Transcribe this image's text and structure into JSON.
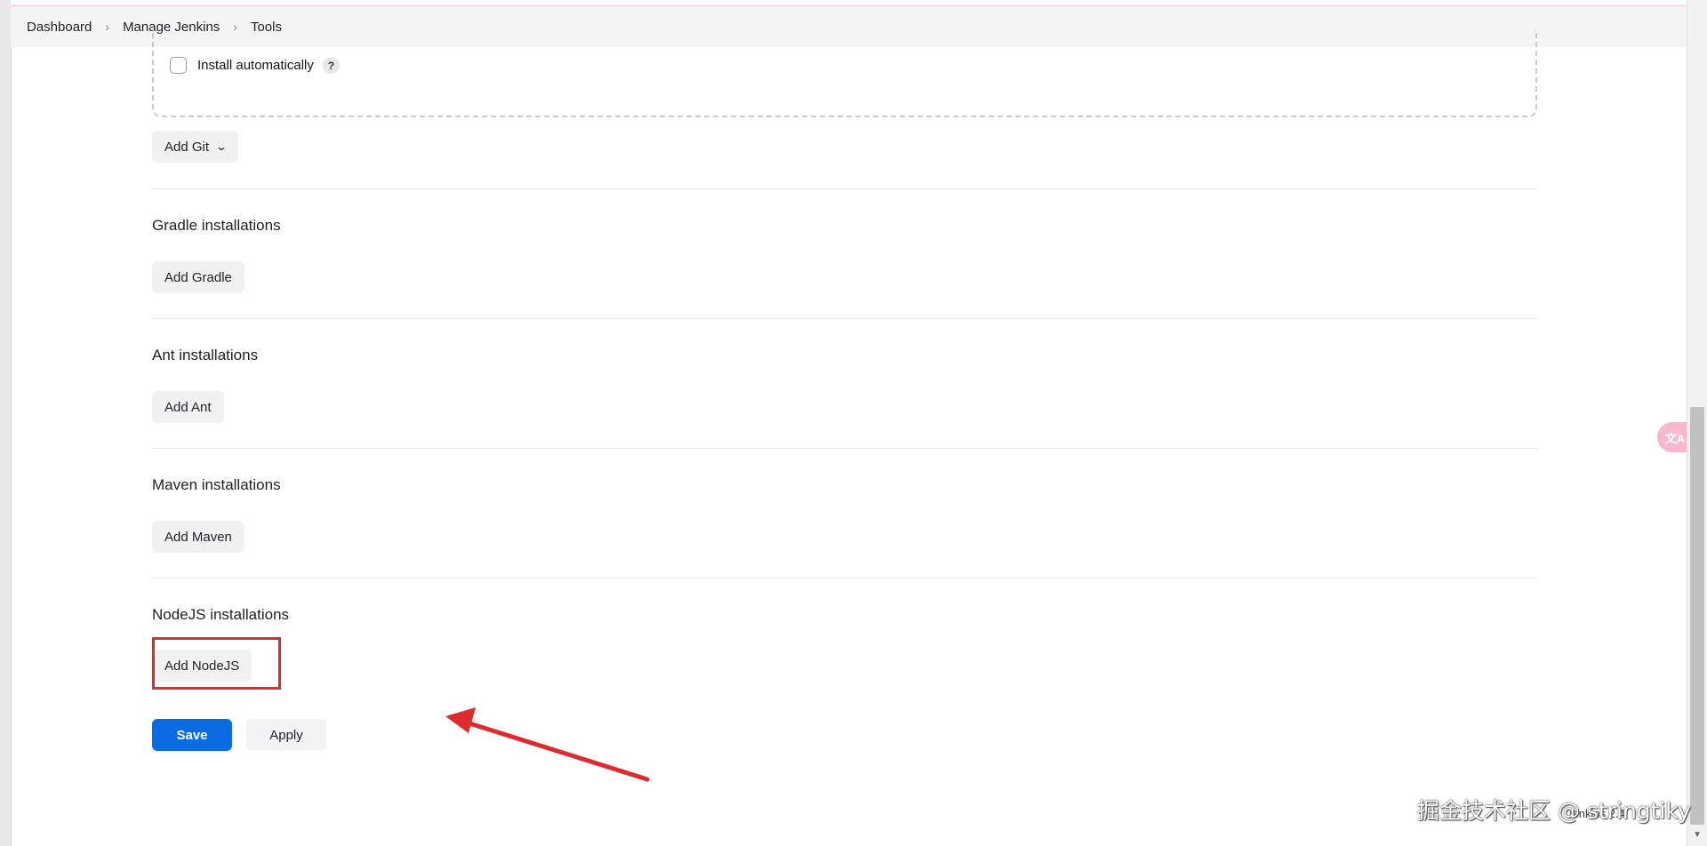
{
  "breadcrumb": {
    "items": [
      "Dashboard",
      "Manage Jenkins",
      "Tools"
    ],
    "separator": "›"
  },
  "git": {
    "install_automatically_label": "Install automatically",
    "install_automatically_checked": false,
    "help_label": "?",
    "add_button": "Add Git"
  },
  "sections": {
    "gradle": {
      "title": "Gradle installations",
      "add_button": "Add Gradle"
    },
    "ant": {
      "title": "Ant installations",
      "add_button": "Add Ant"
    },
    "maven": {
      "title": "Maven installations",
      "add_button": "Add Maven"
    },
    "nodejs": {
      "title": "NodeJS installations",
      "add_button": "Add NodeJS"
    }
  },
  "actions": {
    "save": "Save",
    "apply": "Apply"
  },
  "footer": {
    "version": "Jenkins 2.4"
  },
  "watermark": "掘金技术社区 @ stringtiky",
  "translate_widget": "文A",
  "colors": {
    "primary": "#0b6be2",
    "highlight": "#de2b2f",
    "translate_pill": "#f6b8ce"
  },
  "icons": {
    "breadcrumb_separator": "chevron-right-icon",
    "add_git_dropdown": "chevron-down-icon",
    "help": "question-mark-icon",
    "annotation": "red-arrow-icon",
    "translate": "translate-icon"
  }
}
